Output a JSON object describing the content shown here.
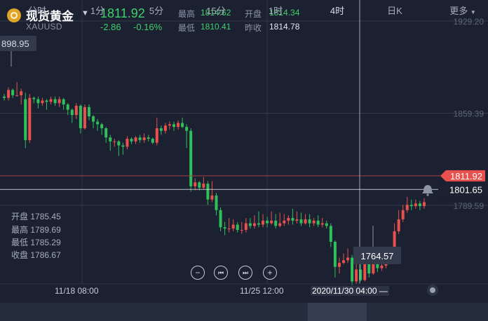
{
  "header": {
    "instrument_name": "现货黄金",
    "instrument_code": "XAUUSD",
    "last_price": "1811.92",
    "change": "-2.86",
    "change_pct": "-0.16%",
    "high_label": "最高",
    "high_value": "1814.62",
    "open_label": "开盘",
    "open_value": "1814.34",
    "low_label": "最低",
    "low_value": "1810.41",
    "prev_close_label": "昨收",
    "prev_close_value": "1814.78"
  },
  "colors": {
    "background": "#1b2131",
    "up": "#e9514e",
    "down": "#2fbf5b",
    "price_tag": "#e9514e",
    "crosshair": "#d9dde4"
  },
  "crosshair_info": {
    "open_label": "开盘",
    "open_value": "1785.45",
    "high_label": "最高",
    "high_value": "1789.69",
    "low_label": "最低",
    "low_value": "1785.29",
    "close_label": "收盘",
    "close_value": "1786.67",
    "time": "2020/11/30 04:00",
    "price": "1801.65"
  },
  "markers": {
    "top_left": "898.95",
    "low": "1764.57"
  },
  "controls": {
    "zoom_out": "−",
    "prev": "⏮",
    "next": "⏭",
    "zoom_in": "+"
  },
  "chart_data": {
    "type": "candlestick",
    "y_ticks": [
      "1929.20",
      "1859.39",
      "1789.59"
    ],
    "x_ticks": [
      "11/18 08:00",
      "11/25 12:00"
    ],
    "current_price": 1811.92,
    "candles": [
      [
        1872,
        1871,
        1874,
        1869
      ],
      [
        1871,
        1877,
        1879,
        1869
      ],
      [
        1877,
        1873,
        1878,
        1871
      ],
      [
        1873,
        1873,
        1883,
        1872
      ],
      [
        1873,
        1876,
        1878,
        1866
      ],
      [
        1870,
        1839,
        1875,
        1833
      ],
      [
        1839,
        1871,
        1874,
        1837
      ],
      [
        1871,
        1870,
        1872,
        1867
      ],
      [
        1870,
        1867,
        1872,
        1863
      ],
      [
        1867,
        1869,
        1871,
        1865
      ],
      [
        1869,
        1868,
        1870,
        1862
      ],
      [
        1868,
        1870,
        1872,
        1866
      ],
      [
        1870,
        1867,
        1872,
        1865
      ],
      [
        1867,
        1870,
        1872,
        1864
      ],
      [
        1870,
        1866,
        1871,
        1862
      ],
      [
        1866,
        1862,
        1867,
        1858
      ],
      [
        1862,
        1858,
        1863,
        1852
      ],
      [
        1858,
        1865,
        1867,
        1855
      ],
      [
        1865,
        1848,
        1866,
        1844
      ],
      [
        1848,
        1864,
        1866,
        1847
      ],
      [
        1864,
        1857,
        1866,
        1854
      ],
      [
        1857,
        1853,
        1858,
        1848
      ],
      [
        1853,
        1851,
        1855,
        1846
      ],
      [
        1851,
        1848,
        1852,
        1843
      ],
      [
        1848,
        1841,
        1849,
        1837
      ],
      [
        1841,
        1838,
        1843,
        1831
      ],
      [
        1838,
        1838,
        1840,
        1834
      ],
      [
        1838,
        1835,
        1839,
        1827
      ],
      [
        1835,
        1834,
        1837,
        1828
      ],
      [
        1834,
        1840,
        1842,
        1832
      ],
      [
        1840,
        1838,
        1841,
        1836
      ],
      [
        1838,
        1841,
        1842,
        1836
      ],
      [
        1841,
        1839,
        1843,
        1837
      ],
      [
        1839,
        1841,
        1844,
        1837
      ],
      [
        1841,
        1840,
        1843,
        1838
      ],
      [
        1840,
        1837,
        1841,
        1836
      ],
      [
        1837,
        1848,
        1856,
        1835
      ],
      [
        1848,
        1846,
        1850,
        1843
      ],
      [
        1846,
        1850,
        1852,
        1844
      ],
      [
        1850,
        1851,
        1853,
        1847
      ],
      [
        1851,
        1849,
        1853,
        1846
      ],
      [
        1849,
        1852,
        1854,
        1847
      ],
      [
        1852,
        1849,
        1856,
        1848
      ],
      [
        1849,
        1846,
        1851,
        1833
      ],
      [
        1846,
        1804,
        1848,
        1800
      ],
      [
        1804,
        1807,
        1810,
        1801
      ],
      [
        1807,
        1803,
        1808,
        1801
      ],
      [
        1803,
        1806,
        1811,
        1802
      ],
      [
        1806,
        1794,
        1808,
        1790
      ],
      [
        1794,
        1797,
        1808,
        1792
      ],
      [
        1797,
        1786,
        1799,
        1782
      ],
      [
        1786,
        1773,
        1788,
        1770
      ],
      [
        1773,
        1772,
        1777,
        1767
      ],
      [
        1772,
        1772,
        1780,
        1769
      ],
      [
        1772,
        1775,
        1779,
        1770
      ],
      [
        1775,
        1771,
        1777,
        1769
      ],
      [
        1771,
        1771,
        1777,
        1768
      ],
      [
        1771,
        1776,
        1780,
        1769
      ],
      [
        1776,
        1774,
        1780,
        1772
      ],
      [
        1774,
        1776,
        1782,
        1772
      ],
      [
        1776,
        1775,
        1785,
        1773
      ],
      [
        1775,
        1778,
        1783,
        1773
      ],
      [
        1778,
        1776,
        1781,
        1773
      ],
      [
        1776,
        1778,
        1785,
        1775
      ],
      [
        1778,
        1774,
        1783,
        1772
      ],
      [
        1774,
        1776,
        1784,
        1773
      ],
      [
        1776,
        1778,
        1783,
        1774
      ],
      [
        1778,
        1780,
        1782,
        1775
      ],
      [
        1780,
        1778,
        1787,
        1775
      ],
      [
        1778,
        1779,
        1785,
        1776
      ],
      [
        1779,
        1776,
        1784,
        1774
      ],
      [
        1776,
        1779,
        1783,
        1775
      ],
      [
        1779,
        1776,
        1783,
        1773
      ],
      [
        1776,
        1778,
        1780,
        1774
      ],
      [
        1778,
        1775,
        1782,
        1773
      ],
      [
        1775,
        1776,
        1780,
        1773
      ],
      [
        1776,
        1774,
        1778,
        1772
      ],
      [
        1774,
        1762,
        1776,
        1758
      ],
      [
        1762,
        1743,
        1763,
        1735
      ],
      [
        1743,
        1746,
        1750,
        1738
      ],
      [
        1746,
        1748,
        1753,
        1745
      ],
      [
        1748,
        1750,
        1757,
        1746
      ],
      [
        1750,
        1732,
        1752,
        1729
      ],
      [
        1732,
        1741,
        1745,
        1730
      ],
      [
        1741,
        1733,
        1747,
        1732
      ],
      [
        1733,
        1745,
        1749,
        1732
      ],
      [
        1745,
        1738,
        1746,
        1735
      ],
      [
        1738,
        1745,
        1747,
        1737
      ],
      [
        1745,
        1742,
        1747,
        1739
      ],
      [
        1742,
        1744,
        1749,
        1740
      ],
      [
        1744,
        1747,
        1755,
        1742
      ],
      [
        1747,
        1754,
        1756,
        1745
      ],
      [
        1754,
        1770,
        1776,
        1752
      ],
      [
        1770,
        1779,
        1786,
        1768
      ],
      [
        1779,
        1786,
        1790,
        1777
      ],
      [
        1786,
        1790,
        1796,
        1784
      ],
      [
        1790,
        1789,
        1794,
        1786
      ],
      [
        1789,
        1791,
        1794,
        1787
      ],
      [
        1791,
        1789,
        1793,
        1786
      ],
      [
        1789,
        1792,
        1795,
        1787
      ]
    ]
  },
  "tabs": [
    "分时",
    "1分",
    "5分",
    "15分",
    "1时",
    "4时",
    "日K",
    "更多"
  ],
  "active_tab": "4时"
}
